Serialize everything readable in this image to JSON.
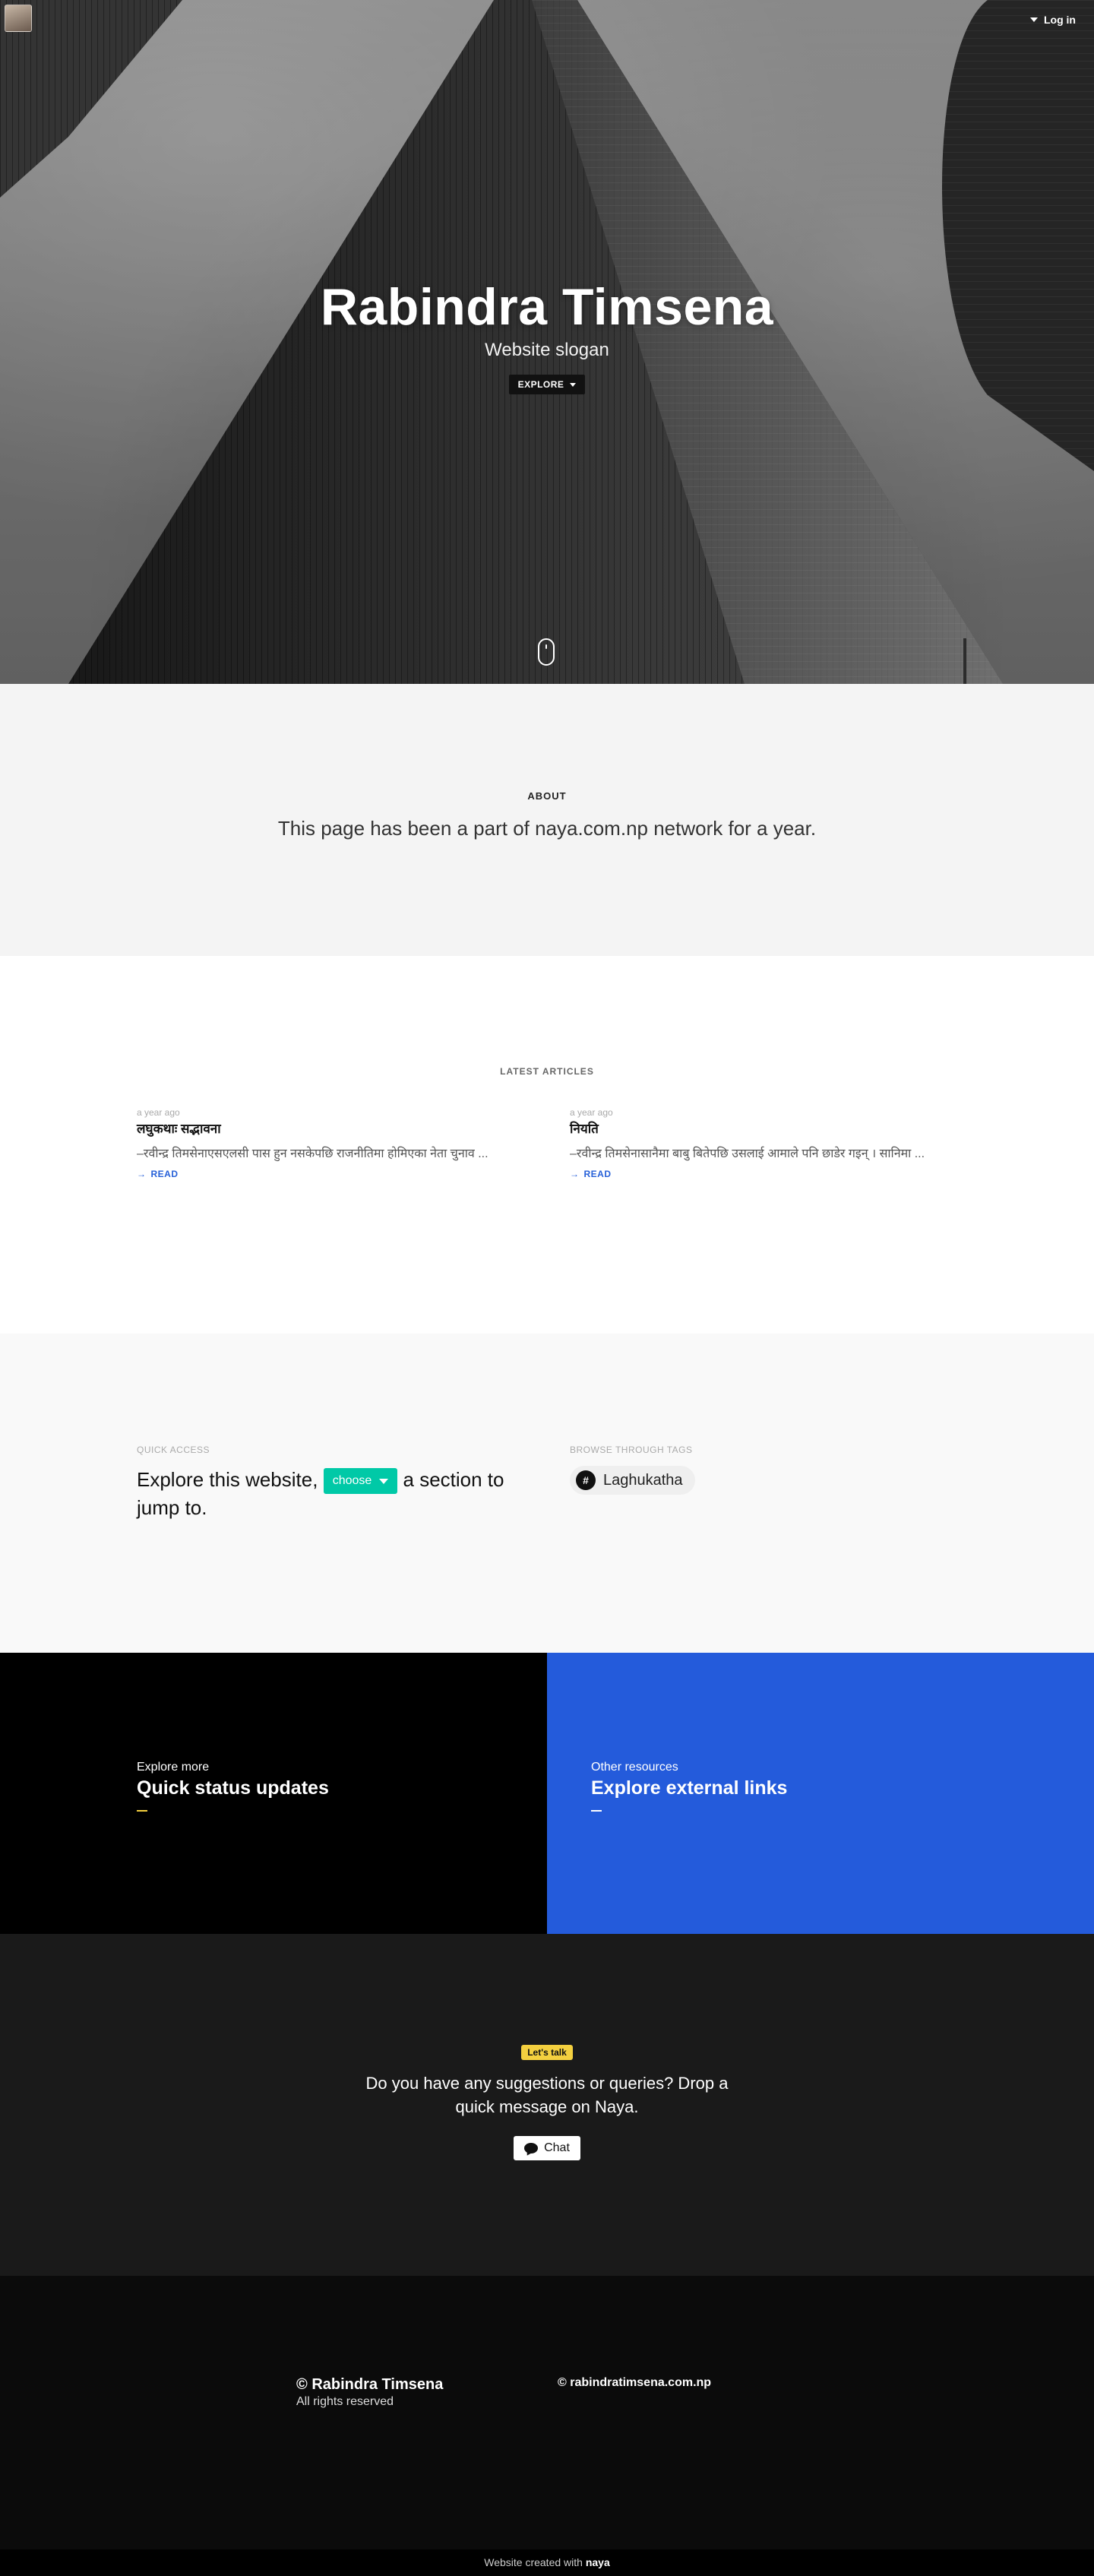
{
  "header": {
    "login_label": "Log in"
  },
  "hero": {
    "title": "Rabindra Timsena",
    "slogan": "Website slogan",
    "explore_label": "EXPLORE"
  },
  "about": {
    "label": "ABOUT",
    "text": "This page has been a part of naya.com.np network for a year."
  },
  "articles": {
    "label": "LATEST ARTICLES",
    "items": [
      {
        "time": "a year ago",
        "title": "लघुकथाः सद्भावना",
        "excerpt": "–रवीन्द्र तिमसेनाएसएलसी पास हुन नसकेपछि राजनीतिमा होमिएका नेता चुनाव ...",
        "read": "READ"
      },
      {
        "time": "a year ago",
        "title": "नियति",
        "excerpt": "–रवीन्द्र तिमसेनासानैमा बाबु बितेपछि उसलाई आमाले पनि छाडेर गइन् । सानिमा ...",
        "read": "READ"
      }
    ]
  },
  "quick": {
    "label": "QUICK ACCESS",
    "text_before": "Explore this website,",
    "choose_label": "choose",
    "text_after": "a section to jump to.",
    "tags_label": "BROWSE THROUGH TAGS",
    "tags": [
      "Laghukatha"
    ]
  },
  "split": {
    "left": {
      "sub": "Explore more",
      "title": "Quick status updates"
    },
    "right": {
      "sub": "Other resources",
      "title": "Explore external links"
    }
  },
  "talk": {
    "badge": "Let's talk",
    "text": "Do you have any suggestions or queries? Drop a quick message on Naya.",
    "chat_label": "Chat"
  },
  "footer": {
    "name": "Rabindra Timsena",
    "rights": "All rights reserved",
    "domain": "rabindratimsena.com.np",
    "created_prefix": "Website created with",
    "created_brand": "naya"
  },
  "colors": {
    "accent_teal": "#00c9a7",
    "accent_blue": "#245bdb",
    "badge_yellow": "#f4d03f"
  }
}
